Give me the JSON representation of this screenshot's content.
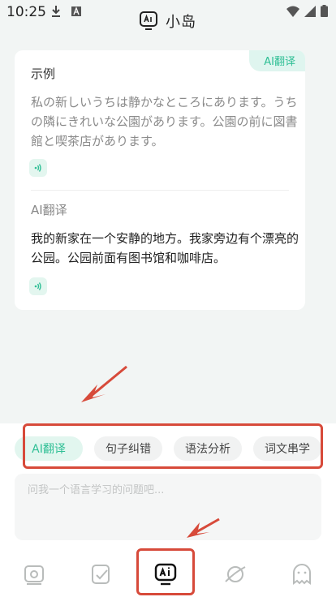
{
  "status_bar": {
    "time": "10:25"
  },
  "header": {
    "title": "小岛"
  },
  "card": {
    "badge": "AI翻译",
    "example_label": "示例",
    "example_text": "私の新しいうちは静かなところにあります。うちの隣にきれいな公園があります。公園の前に図書館と喫茶店があります。",
    "translation_label": "AI翻译",
    "translation_text": "我的新家在一个安静的地方。我家旁边有个漂亮的公园。公园前面有图书馆和咖啡店。"
  },
  "chips": [
    {
      "label": "AI翻译"
    },
    {
      "label": "句子纠错"
    },
    {
      "label": "语法分析"
    },
    {
      "label": "词文串学"
    }
  ],
  "input": {
    "placeholder": "问我一个语言学习的问题吧..."
  },
  "colors": {
    "accent": "#2fbf95",
    "annotation": "#d74a3a"
  },
  "tabs": [
    {
      "icon": "photo-icon"
    },
    {
      "icon": "note-check-icon"
    },
    {
      "icon": "ai-chat-icon"
    },
    {
      "icon": "planet-icon"
    },
    {
      "icon": "ghost-icon"
    }
  ]
}
